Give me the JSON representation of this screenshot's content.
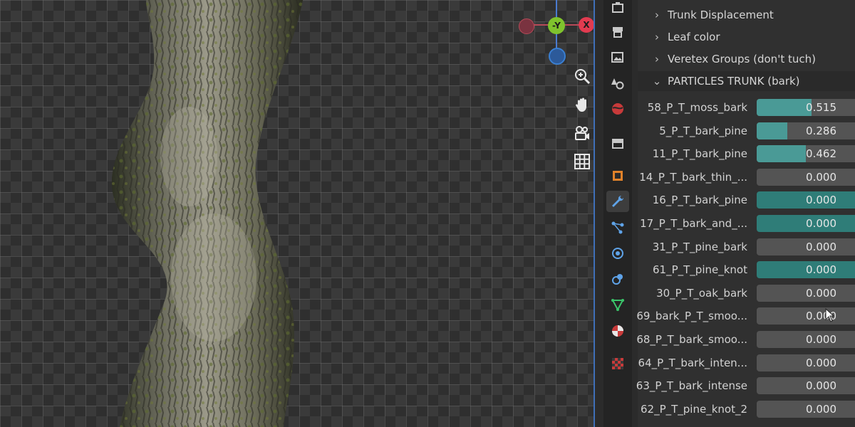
{
  "gizmo": {
    "neg_y_label": "-Y",
    "x_label": "X",
    "colors": {
      "x": "#e23b50",
      "y": "#7fc32d",
      "z": "#3a7fd2"
    }
  },
  "viewport_nav": [
    {
      "name": "zoom-icon"
    },
    {
      "name": "hand-pan-icon"
    },
    {
      "name": "camera-icon"
    },
    {
      "name": "grid-icon"
    }
  ],
  "tool_tabs": [
    {
      "name": "tool-icon"
    },
    {
      "name": "render-icon"
    },
    {
      "name": "output-icon"
    },
    {
      "name": "view-layer-icon"
    },
    {
      "name": "scene-icon"
    },
    {
      "name": "world-icon"
    },
    {
      "name": "collection-icon"
    },
    {
      "name": "object-icon"
    },
    {
      "name": "modifier-wrench-icon",
      "active": true
    },
    {
      "name": "particles-icon"
    },
    {
      "name": "physics-icon"
    },
    {
      "name": "constraints-icon"
    },
    {
      "name": "object-data-icon"
    },
    {
      "name": "material-icon"
    },
    {
      "name": "texture-icon"
    }
  ],
  "panel": {
    "sections": [
      {
        "label": "Trunk Displacement",
        "open": false
      },
      {
        "label": "Leaf color",
        "open": false
      },
      {
        "label": "Veretex Groups (don't tuch)",
        "open": false
      },
      {
        "label": "PARTICLES TRUNK (bark)",
        "open": true
      }
    ],
    "properties": [
      {
        "label": "58_P_T_moss_bark",
        "value": "0.515",
        "fraction": 0.515,
        "keyed": false
      },
      {
        "label": "5_P_T_bark_pine",
        "value": "0.286",
        "fraction": 0.286,
        "keyed": false
      },
      {
        "label": "11_P_T_bark_pine",
        "value": "0.462",
        "fraction": 0.462,
        "keyed": false
      },
      {
        "label": "14_P_T_bark_thin_...",
        "value": "0.000",
        "fraction": 0,
        "keyed": false
      },
      {
        "label": "16_P_T_bark_pine",
        "value": "0.000",
        "fraction": 0,
        "keyed": true
      },
      {
        "label": "17_P_T_bark_and_...",
        "value": "0.000",
        "fraction": 0,
        "keyed": true
      },
      {
        "label": "31_P_T_pine_bark",
        "value": "0.000",
        "fraction": 0,
        "keyed": false
      },
      {
        "label": "61_P_T_pine_knot",
        "value": "0.000",
        "fraction": 0,
        "keyed": true
      },
      {
        "label": "30_P_T_oak_bark",
        "value": "0.000",
        "fraction": 0,
        "keyed": false
      },
      {
        "label": "69_bark_P_T_smoo...",
        "value": "0.000",
        "fraction": 0,
        "keyed": false
      },
      {
        "label": "68_P_T_bark_smoo...",
        "value": "0.000",
        "fraction": 0,
        "keyed": false
      },
      {
        "label": "64_P_T_bark_inten...",
        "value": "0.000",
        "fraction": 0,
        "keyed": false
      },
      {
        "label": "63_P_T_bark_intense",
        "value": "0.000",
        "fraction": 0,
        "keyed": false
      },
      {
        "label": "62_P_T_pine_knot_2",
        "value": "0.000",
        "fraction": 0,
        "keyed": false
      }
    ]
  }
}
